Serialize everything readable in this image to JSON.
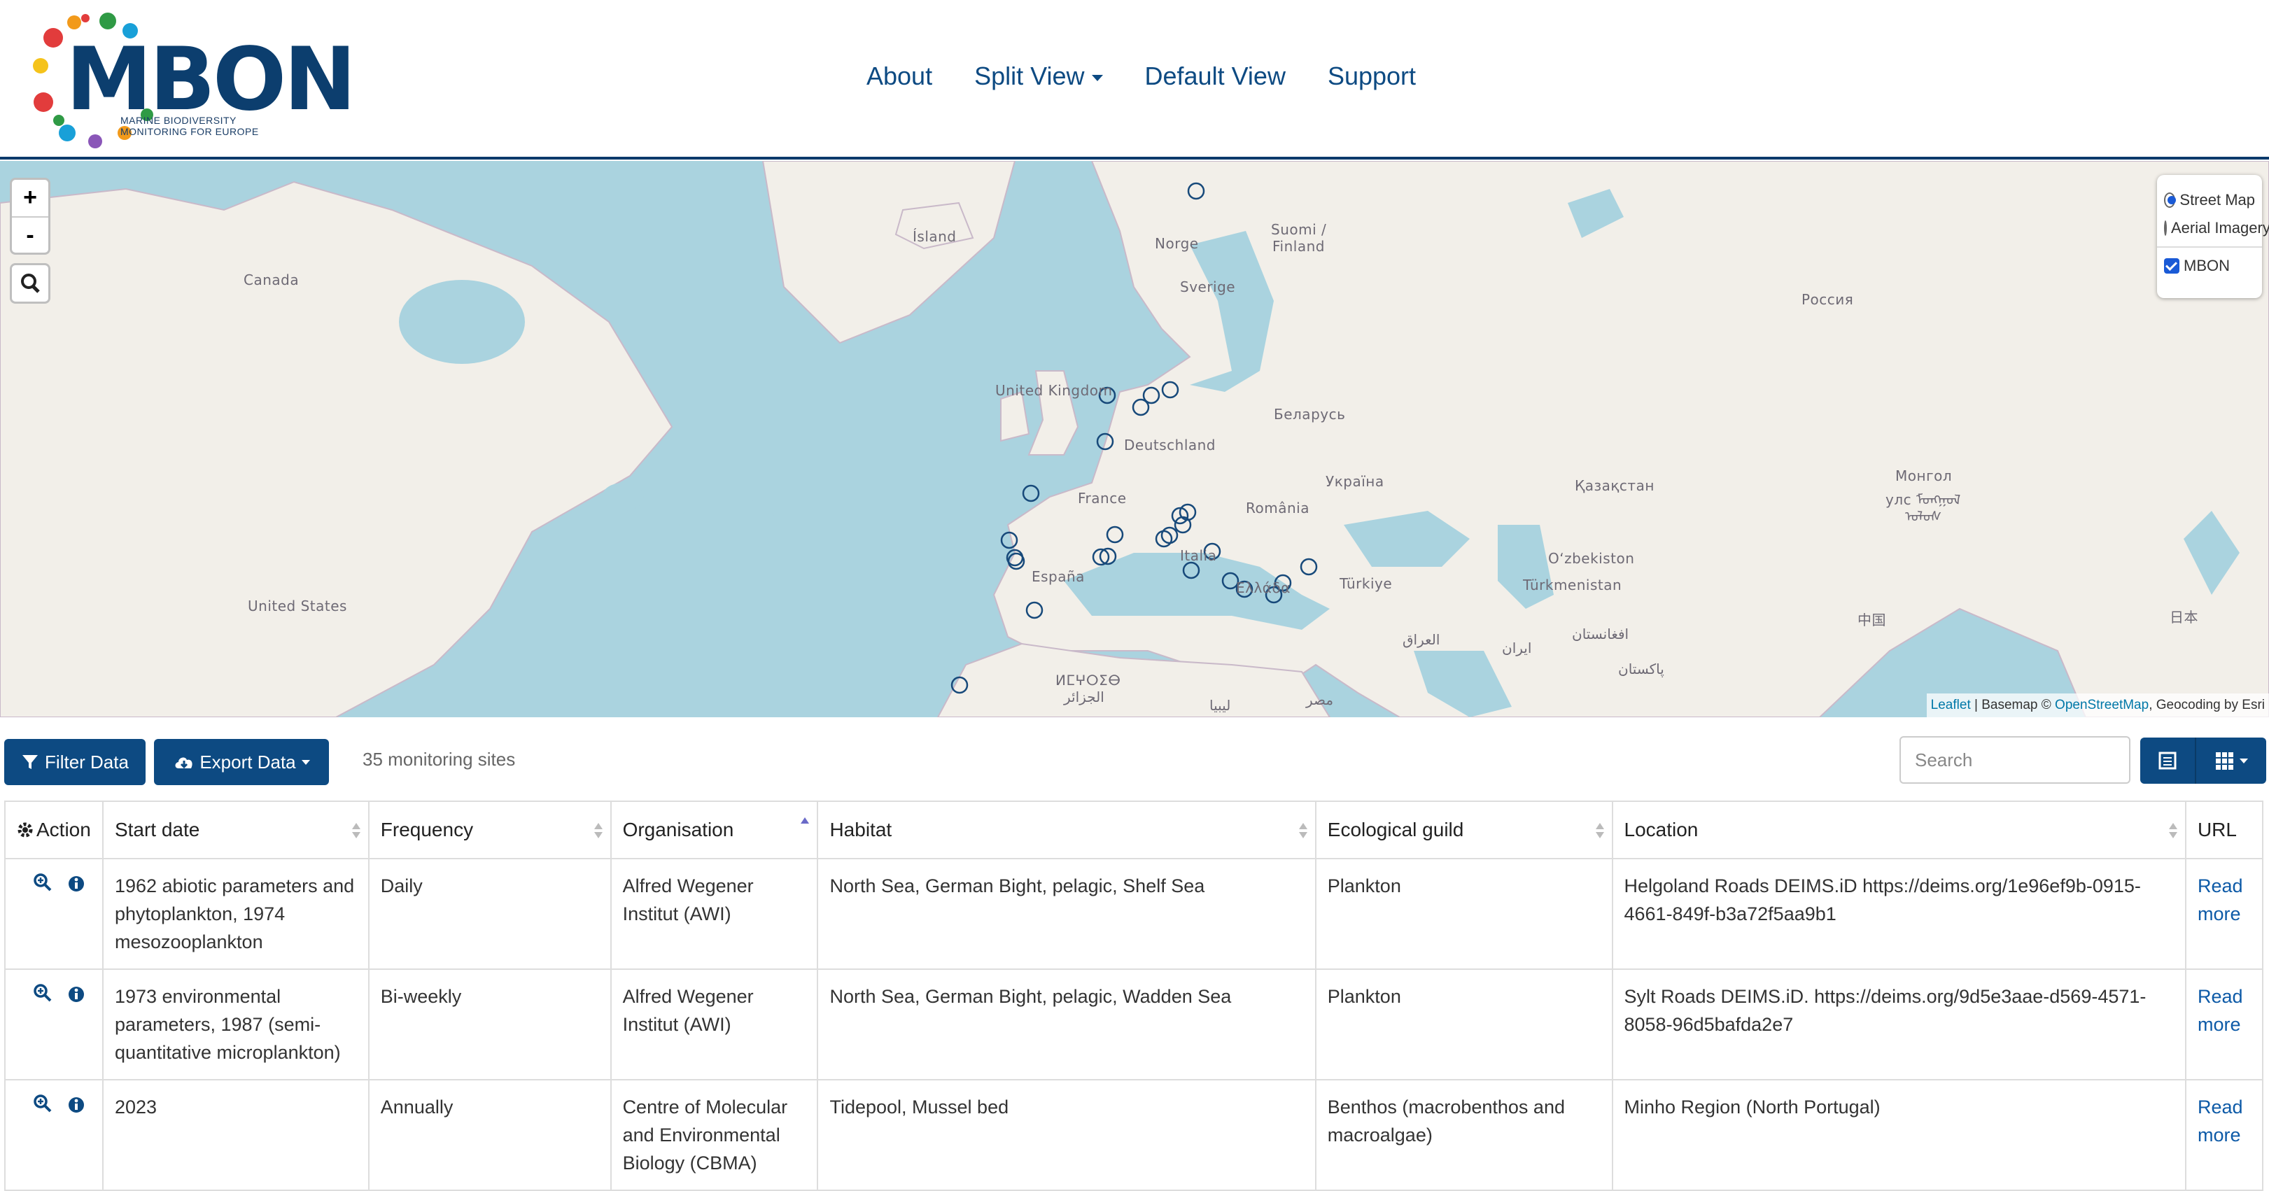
{
  "brand": {
    "name": "MBON",
    "subtitle_line1": "MARINE BIODIVERSITY",
    "subtitle_line2": "MONITORING FOR EUROPE"
  },
  "nav": {
    "about": "About",
    "split_view": "Split View",
    "default_view": "Default View",
    "support": "Support"
  },
  "map": {
    "zoom_in": "+",
    "zoom_out": "-",
    "labels": {
      "island": "Ísland",
      "norge": "Norge",
      "suomi1": "Suomi /",
      "suomi2": "Finland",
      "sverige": "Sverige",
      "canada": "Canada",
      "rossiya": "Россия",
      "uk": "United Kingdom",
      "deutschland": "Deutschland",
      "belarus": "Беларусь",
      "france": "France",
      "ukraina": "Україна",
      "romania": "România",
      "kazakhstan": "Қазақстан",
      "mongol1": "Монгол",
      "mongol2": "улс ᠮᠣᠩᠭᠣᠯ",
      "mongol3": "ᠤᠯᠤᠰ",
      "italia": "Italia",
      "espana": "España",
      "ellada": "Ελλάδα",
      "turkiye": "Türkiye",
      "uzbekistan": "O‘zbekiston",
      "turkmenistan": "Türkmenistan",
      "usa": "United States",
      "iraq": "العراق",
      "iran": "ایران",
      "afghanistan": "افغانستان",
      "pakistan": "پاکستان",
      "china": "中国",
      "japan": "日本",
      "morocco": "ⵍⵎⵖⵔⵉⴱ",
      "algeria": "الجزائر",
      "libya": "ليبيا",
      "egypt": "مصر"
    },
    "layers": {
      "street": "Street Map",
      "aerial": "Aerial Imagery",
      "mbon": "MBON"
    },
    "attribution": {
      "leaflet": "Leaflet",
      "text": " | Basemap © ",
      "osm": "OpenStreetMap",
      "tail": ", Geocoding by Esri"
    }
  },
  "toolbar": {
    "filter": "Filter Data",
    "export": "Export Data",
    "count": "35 monitoring sites",
    "search_placeholder": "Search"
  },
  "table": {
    "headers": [
      "Action",
      "Start date",
      "Frequency",
      "Organisation",
      "Habitat",
      "Ecological guild",
      "Location",
      "URL"
    ],
    "rows": [
      {
        "start": "1962 abiotic parameters and phytoplankton, 1974 mesozooplankton",
        "frequency": "Daily",
        "organisation": "Alfred Wegener Institut (AWI)",
        "habitat": "North Sea, German Bight, pelagic, Shelf Sea",
        "guild": "Plankton",
        "location": "Helgoland Roads DEIMS.iD https://deims.org/1e96ef9b-0915-4661-849f-b3a72f5aa9b1",
        "url": "Read more"
      },
      {
        "start": "1973 environmental parameters, 1987 (semi-quantitative microplankton)",
        "frequency": "Bi-weekly",
        "organisation": "Alfred Wegener Institut (AWI)",
        "habitat": "North Sea, German Bight, pelagic, Wadden Sea",
        "guild": "Plankton",
        "location": "Sylt Roads DEIMS.iD. https://deims.org/9d5e3aae-d569-4571-8058-96d5bafda2e7",
        "url": "Read more"
      },
      {
        "start": "2023",
        "frequency": "Annually",
        "organisation": "Centre of Molecular and Environmental Biology (CBMA)",
        "habitat": "Tidepool, Mussel bed",
        "guild": "Benthos (macrobenthos and macroalgae)",
        "location": "Minho Region (North Portugal)",
        "url": "Read more"
      }
    ]
  },
  "colors": {
    "brand": "#0c3e6e",
    "button": "#0d4a82",
    "water": "#aad3df",
    "land": "#f2efe9",
    "marker": "#17497a"
  }
}
